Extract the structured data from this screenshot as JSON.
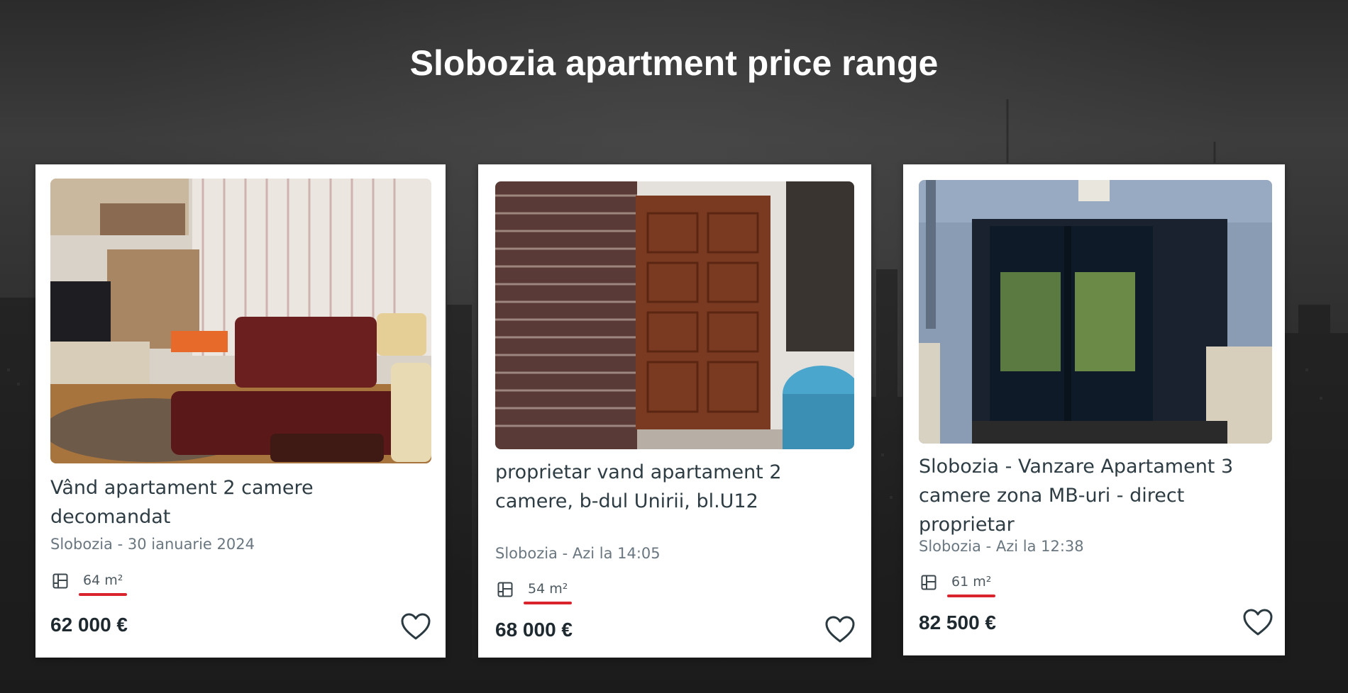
{
  "page": {
    "title": "Slobozia apartment price range"
  },
  "listings": [
    {
      "title": "Vând apartament 2 camere decomandat",
      "meta": "Slobozia - 30 ianuarie 2024",
      "area": "64 m²",
      "price": "62 000 €",
      "photo_icon": "living-room-photo",
      "favorite_icon": "heart-outline-icon"
    },
    {
      "title": "proprietar vand apartament 2 camere, b-dul Unirii, bl.U12",
      "meta": "Slobozia - Azi la 14:05",
      "area": "54 m²",
      "price": "68 000 €",
      "photo_icon": "balcony-door-photo",
      "favorite_icon": "heart-outline-icon"
    },
    {
      "title": "Slobozia - Vanzare Apartament 3 camere zona MB-uri - direct proprietar",
      "meta": "Slobozia - Azi la 12:38",
      "area": "61 m²",
      "price": "82 500 €",
      "photo_icon": "building-entrance-photo",
      "favorite_icon": "heart-outline-icon"
    }
  ],
  "colors": {
    "accent_underline": "#d9232d",
    "title_text": "#2e3c44",
    "price_text": "#1f2a30"
  }
}
